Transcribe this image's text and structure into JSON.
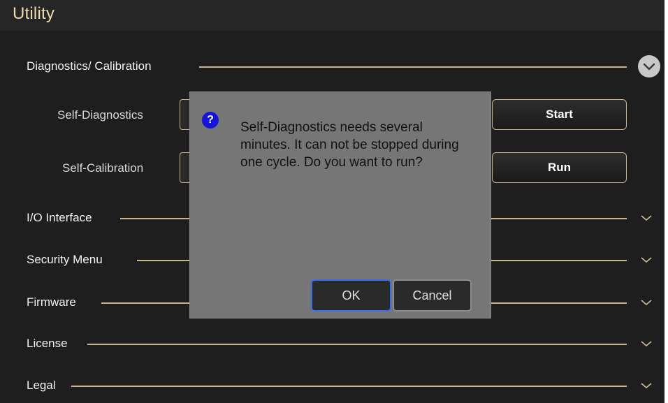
{
  "window": {
    "title": "Utility"
  },
  "sections": {
    "diag": {
      "label": "Diagnostics/ Calibration"
    },
    "io": {
      "label": "I/O Interface"
    },
    "security": {
      "label": "Security Menu"
    },
    "firmware": {
      "label": "Firmware"
    },
    "license": {
      "label": "License"
    },
    "legal": {
      "label": "Legal"
    }
  },
  "diagnostics": {
    "self_diag_label": "Self-Diagnostics",
    "self_diag_button": "Start",
    "self_cal_label": "Self-Calibration",
    "self_cal_button": "Run"
  },
  "dialog": {
    "icon": "?",
    "message": "Self-Diagnostics needs several minutes. It can not be stopped during one cycle. Do you want to run?",
    "ok_label": "OK",
    "cancel_label": "Cancel"
  },
  "colors": {
    "accent_line": "#c9b48c",
    "title": "#efd9b0",
    "question_icon": "#1515d8",
    "ok_focus": "#3b6df0"
  }
}
